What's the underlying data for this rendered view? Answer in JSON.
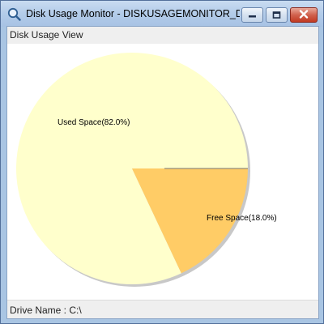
{
  "window": {
    "title": "Disk Usage Monitor - DISKUSAGEMONITOR_Dis..."
  },
  "view": {
    "label": "Disk Usage View"
  },
  "footer": {
    "drive_label": "Drive Name : C:\\"
  },
  "chart_data": {
    "type": "pie",
    "categories": [
      "Used Space",
      "Free Space"
    ],
    "values": [
      82.0,
      18.0
    ],
    "labels": [
      "Used Space(82.0%)",
      "Free Space(18.0%)"
    ],
    "colors": [
      "#ffffcc",
      "#ffcc66"
    ],
    "title": ""
  }
}
